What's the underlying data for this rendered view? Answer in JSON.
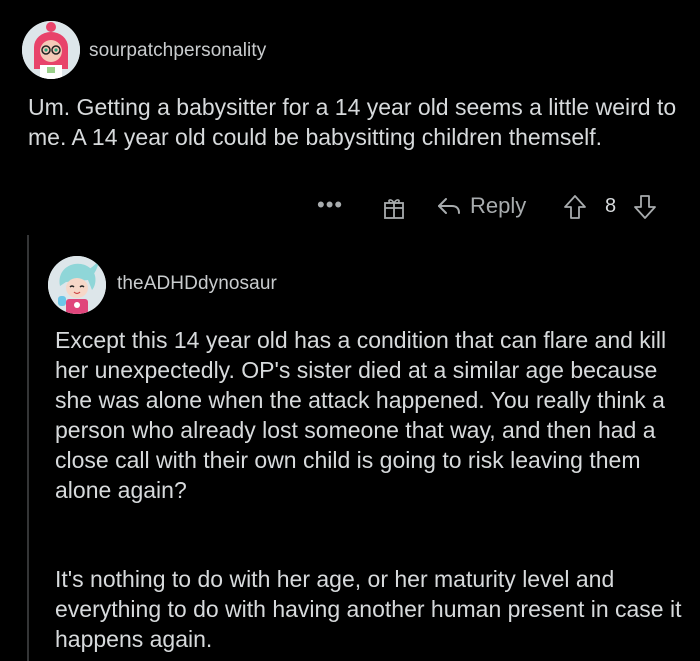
{
  "parent_comment": {
    "username": "sourpatchpersonality",
    "body": "Um. Getting a babysitter for a 14 year old seems a little weird to me. A 14 year old could be babysitting children themself.",
    "actions": {
      "more_label": "•••",
      "reply_label": "Reply",
      "score": "8",
      "icons": [
        "more-icon",
        "award-icon",
        "reply-icon",
        "upvote-icon",
        "downvote-icon"
      ]
    }
  },
  "reply_comment": {
    "username": "theADHDdynosaur",
    "paragraphs": [
      "Except this 14 year old has a condition that can flare and kill her unexpectedly. OP's sister died at a similar age because she was alone when the attack happened. You really think a person who already lost someone that way, and then had a close call with their own child is going to risk leaving them alone again?",
      "It's nothing to do with her age, or her maturity level and everything to do with having another human present in case it happens again."
    ]
  },
  "colors": {
    "background": "#000000",
    "text": "#d7dadc",
    "muted": "#a8acae",
    "thread_line": "#343536"
  }
}
